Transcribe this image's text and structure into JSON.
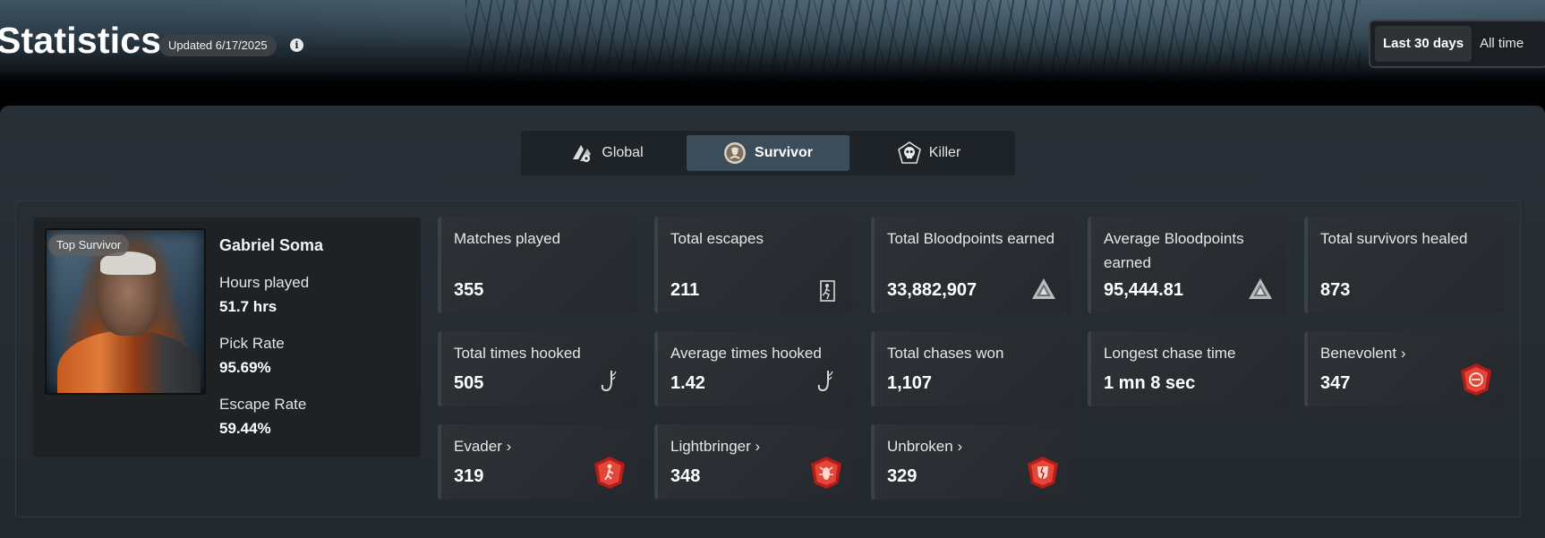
{
  "header": {
    "title": "Statistics",
    "updated": "Updated 6/17/2025",
    "info_icon": "i",
    "periods": [
      {
        "label": "Last 30 days",
        "active": true
      },
      {
        "label": "All time",
        "active": false
      }
    ]
  },
  "role_tabs": [
    {
      "label": "Global",
      "icon": "global-icon",
      "active": false
    },
    {
      "label": "Survivor",
      "icon": "survivor-icon",
      "active": true
    },
    {
      "label": "Killer",
      "icon": "killer-icon",
      "active": false
    }
  ],
  "profile": {
    "badge": "Top Survivor",
    "name": "Gabriel Soma",
    "hours_label": "Hours played",
    "hours_value": "51.7 hrs",
    "pick_label": "Pick Rate",
    "pick_value": "95.69%",
    "escape_label": "Escape Rate",
    "escape_value": "59.44%"
  },
  "cards": [
    {
      "label": "Matches played",
      "value": "355",
      "icon": null
    },
    {
      "label": "Total escapes",
      "value": "211",
      "icon": "exit-door-icon"
    },
    {
      "label": "Total Bloodpoints earned",
      "value": "33,882,907",
      "icon": "bloodpoints-icon"
    },
    {
      "label": "Average Bloodpoints earned",
      "value": "95,444.81",
      "icon": "bloodpoints-icon"
    },
    {
      "label": "Total survivors healed",
      "value": "873",
      "icon": null
    },
    {
      "label": "Total times hooked",
      "value": "505",
      "icon": "hook-icon"
    },
    {
      "label": "Average times hooked",
      "value": "1.42",
      "icon": "hook-icon"
    },
    {
      "label": "Total chases won",
      "value": "1,107",
      "icon": null
    },
    {
      "label": "Longest chase time",
      "value": "1 mn 8 sec",
      "icon": null
    },
    {
      "label": "Benevolent",
      "arrow": "›",
      "value": "347",
      "icon": "benevolent-emblem-icon"
    },
    {
      "label": "Evader",
      "arrow": "›",
      "value": "319",
      "icon": "evader-emblem-icon"
    },
    {
      "label": "Lightbringer",
      "arrow": "›",
      "value": "348",
      "icon": "lightbringer-emblem-icon"
    },
    {
      "label": "Unbroken",
      "arrow": "›",
      "value": "329",
      "icon": "unbroken-emblem-icon"
    }
  ],
  "colors": {
    "emblem_red": "#c8261e",
    "active_tab": "#3b4c5a"
  }
}
